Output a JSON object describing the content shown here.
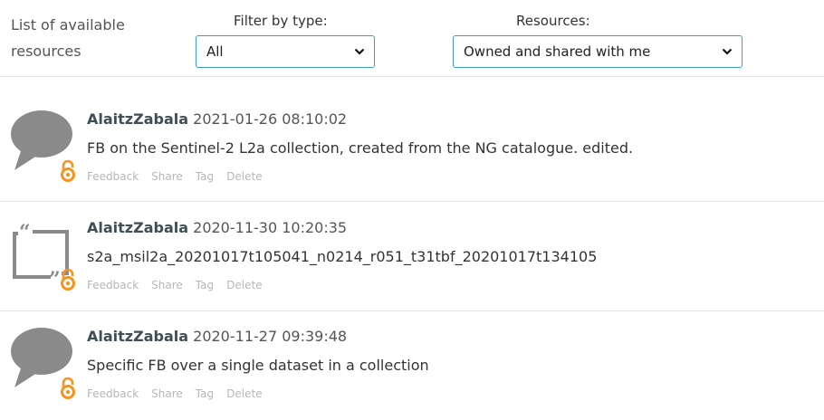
{
  "header": {
    "list_title_line1": "List of available",
    "list_title_line2": "resources",
    "filter_label": "Filter by type:",
    "filter_value": "All",
    "resources_label": "Resources:",
    "resources_value": "Owned and shared with me"
  },
  "items": [
    {
      "user": "AlaitzZabala",
      "date": "2021-01-26 08:10:02",
      "description": "FB on the Sentinel-2 L2a collection, created from the NG catalogue. edited.",
      "icon": "speech-bubble-icon",
      "actions": [
        "Feedback",
        "Share",
        "Tag",
        "Delete"
      ]
    },
    {
      "user": "AlaitzZabala",
      "date": "2020-11-30 10:20:35",
      "description": "s2a_msil2a_20201017t105041_n0214_r051_t31tbf_20201017t134105",
      "icon": "quote-frame-icon",
      "actions": [
        "Feedback",
        "Share",
        "Tag",
        "Delete"
      ]
    },
    {
      "user": "AlaitzZabala",
      "date": "2020-11-27 09:39:48",
      "description": "Specific FB over a single dataset in a collection",
      "icon": "speech-bubble-icon",
      "actions": [
        "Feedback",
        "Share",
        "Tag",
        "Delete"
      ]
    }
  ],
  "colors": {
    "accent_orange": "#f7931e",
    "select_border": "#3a9bd6",
    "icon_gray": "#8a8a8a"
  }
}
